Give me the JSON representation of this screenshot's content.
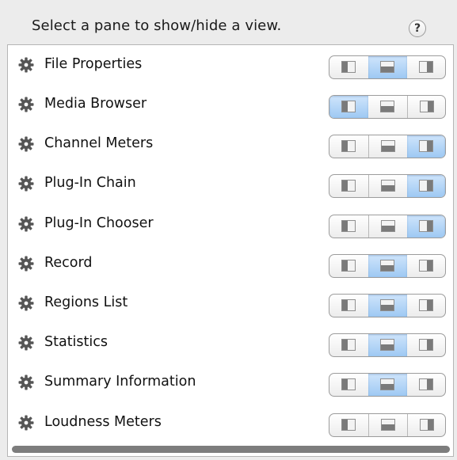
{
  "header": {
    "title": "Select a pane to show/hide a view.",
    "help_label": "?"
  },
  "pane_options": [
    "left-pane",
    "bottom-pane",
    "right-pane"
  ],
  "colors": {
    "selected_segment": "#9ec9f3",
    "pane_fill": "#7a7a7a"
  },
  "rows": [
    {
      "label": "File Properties",
      "selected": 1
    },
    {
      "label": "Media Browser",
      "selected": 0
    },
    {
      "label": "Channel Meters",
      "selected": 2
    },
    {
      "label": "Plug-In Chain",
      "selected": 2
    },
    {
      "label": "Plug-In Chooser",
      "selected": 2
    },
    {
      "label": "Record",
      "selected": 1
    },
    {
      "label": "Regions List",
      "selected": 1
    },
    {
      "label": "Statistics",
      "selected": 1
    },
    {
      "label": "Summary Information",
      "selected": 1
    },
    {
      "label": "Loudness Meters",
      "selected": -1
    }
  ]
}
